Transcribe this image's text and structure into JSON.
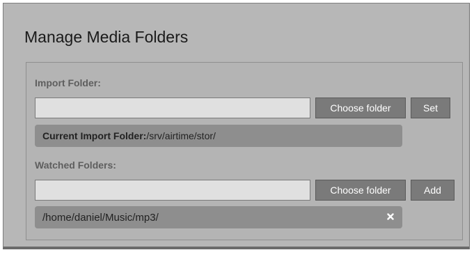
{
  "dialog": {
    "title": "Manage Media Folders"
  },
  "import": {
    "label": "Import Folder:",
    "input_value": "",
    "choose_button": "Choose folder",
    "set_button": "Set",
    "current_label": "Current Import Folder:",
    "current_path": "/srv/airtime/stor/"
  },
  "watched": {
    "label": "Watched Folders:",
    "input_value": "",
    "choose_button": "Choose folder",
    "add_button": "Add",
    "folders": [
      {
        "path": "/home/daniel/Music/mp3/",
        "remove_icon": "close-icon"
      }
    ]
  },
  "colors": {
    "dialog_bg": "#b7b7b7",
    "button_bg": "#7a7a7a",
    "pill_bg": "#8e8e8e",
    "label_text": "#5e5e5e"
  }
}
